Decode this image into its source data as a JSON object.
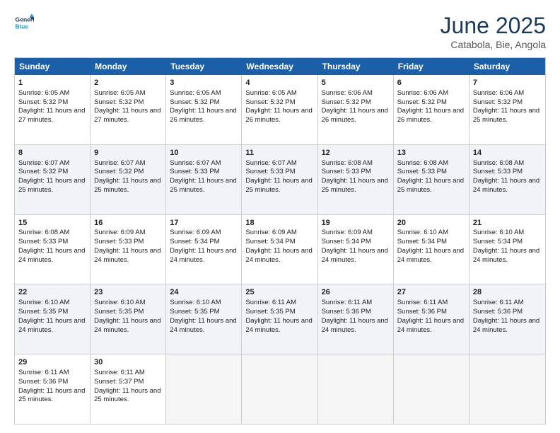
{
  "header": {
    "logo_line1": "General",
    "logo_line2": "Blue",
    "title": "June 2025",
    "subtitle": "Catabola, Bie, Angola"
  },
  "days_of_week": [
    "Sunday",
    "Monday",
    "Tuesday",
    "Wednesday",
    "Thursday",
    "Friday",
    "Saturday"
  ],
  "weeks": [
    [
      {
        "day": 1,
        "sunrise": "6:05 AM",
        "sunset": "5:32 PM",
        "daylight": "11 hours and 27 minutes."
      },
      {
        "day": 2,
        "sunrise": "6:05 AM",
        "sunset": "5:32 PM",
        "daylight": "11 hours and 27 minutes."
      },
      {
        "day": 3,
        "sunrise": "6:05 AM",
        "sunset": "5:32 PM",
        "daylight": "11 hours and 26 minutes."
      },
      {
        "day": 4,
        "sunrise": "6:05 AM",
        "sunset": "5:32 PM",
        "daylight": "11 hours and 26 minutes."
      },
      {
        "day": 5,
        "sunrise": "6:06 AM",
        "sunset": "5:32 PM",
        "daylight": "11 hours and 26 minutes."
      },
      {
        "day": 6,
        "sunrise": "6:06 AM",
        "sunset": "5:32 PM",
        "daylight": "11 hours and 26 minutes."
      },
      {
        "day": 7,
        "sunrise": "6:06 AM",
        "sunset": "5:32 PM",
        "daylight": "11 hours and 25 minutes."
      }
    ],
    [
      {
        "day": 8,
        "sunrise": "6:07 AM",
        "sunset": "5:32 PM",
        "daylight": "11 hours and 25 minutes."
      },
      {
        "day": 9,
        "sunrise": "6:07 AM",
        "sunset": "5:32 PM",
        "daylight": "11 hours and 25 minutes."
      },
      {
        "day": 10,
        "sunrise": "6:07 AM",
        "sunset": "5:33 PM",
        "daylight": "11 hours and 25 minutes."
      },
      {
        "day": 11,
        "sunrise": "6:07 AM",
        "sunset": "5:33 PM",
        "daylight": "11 hours and 25 minutes."
      },
      {
        "day": 12,
        "sunrise": "6:08 AM",
        "sunset": "5:33 PM",
        "daylight": "11 hours and 25 minutes."
      },
      {
        "day": 13,
        "sunrise": "6:08 AM",
        "sunset": "5:33 PM",
        "daylight": "11 hours and 25 minutes."
      },
      {
        "day": 14,
        "sunrise": "6:08 AM",
        "sunset": "5:33 PM",
        "daylight": "11 hours and 24 minutes."
      }
    ],
    [
      {
        "day": 15,
        "sunrise": "6:08 AM",
        "sunset": "5:33 PM",
        "daylight": "11 hours and 24 minutes."
      },
      {
        "day": 16,
        "sunrise": "6:09 AM",
        "sunset": "5:33 PM",
        "daylight": "11 hours and 24 minutes."
      },
      {
        "day": 17,
        "sunrise": "6:09 AM",
        "sunset": "5:34 PM",
        "daylight": "11 hours and 24 minutes."
      },
      {
        "day": 18,
        "sunrise": "6:09 AM",
        "sunset": "5:34 PM",
        "daylight": "11 hours and 24 minutes."
      },
      {
        "day": 19,
        "sunrise": "6:09 AM",
        "sunset": "5:34 PM",
        "daylight": "11 hours and 24 minutes."
      },
      {
        "day": 20,
        "sunrise": "6:10 AM",
        "sunset": "5:34 PM",
        "daylight": "11 hours and 24 minutes."
      },
      {
        "day": 21,
        "sunrise": "6:10 AM",
        "sunset": "5:34 PM",
        "daylight": "11 hours and 24 minutes."
      }
    ],
    [
      {
        "day": 22,
        "sunrise": "6:10 AM",
        "sunset": "5:35 PM",
        "daylight": "11 hours and 24 minutes."
      },
      {
        "day": 23,
        "sunrise": "6:10 AM",
        "sunset": "5:35 PM",
        "daylight": "11 hours and 24 minutes."
      },
      {
        "day": 24,
        "sunrise": "6:10 AM",
        "sunset": "5:35 PM",
        "daylight": "11 hours and 24 minutes."
      },
      {
        "day": 25,
        "sunrise": "6:11 AM",
        "sunset": "5:35 PM",
        "daylight": "11 hours and 24 minutes."
      },
      {
        "day": 26,
        "sunrise": "6:11 AM",
        "sunset": "5:36 PM",
        "daylight": "11 hours and 24 minutes."
      },
      {
        "day": 27,
        "sunrise": "6:11 AM",
        "sunset": "5:36 PM",
        "daylight": "11 hours and 24 minutes."
      },
      {
        "day": 28,
        "sunrise": "6:11 AM",
        "sunset": "5:36 PM",
        "daylight": "11 hours and 24 minutes."
      }
    ],
    [
      {
        "day": 29,
        "sunrise": "6:11 AM",
        "sunset": "5:36 PM",
        "daylight": "11 hours and 25 minutes."
      },
      {
        "day": 30,
        "sunrise": "6:11 AM",
        "sunset": "5:37 PM",
        "daylight": "11 hours and 25 minutes."
      },
      null,
      null,
      null,
      null,
      null
    ]
  ]
}
